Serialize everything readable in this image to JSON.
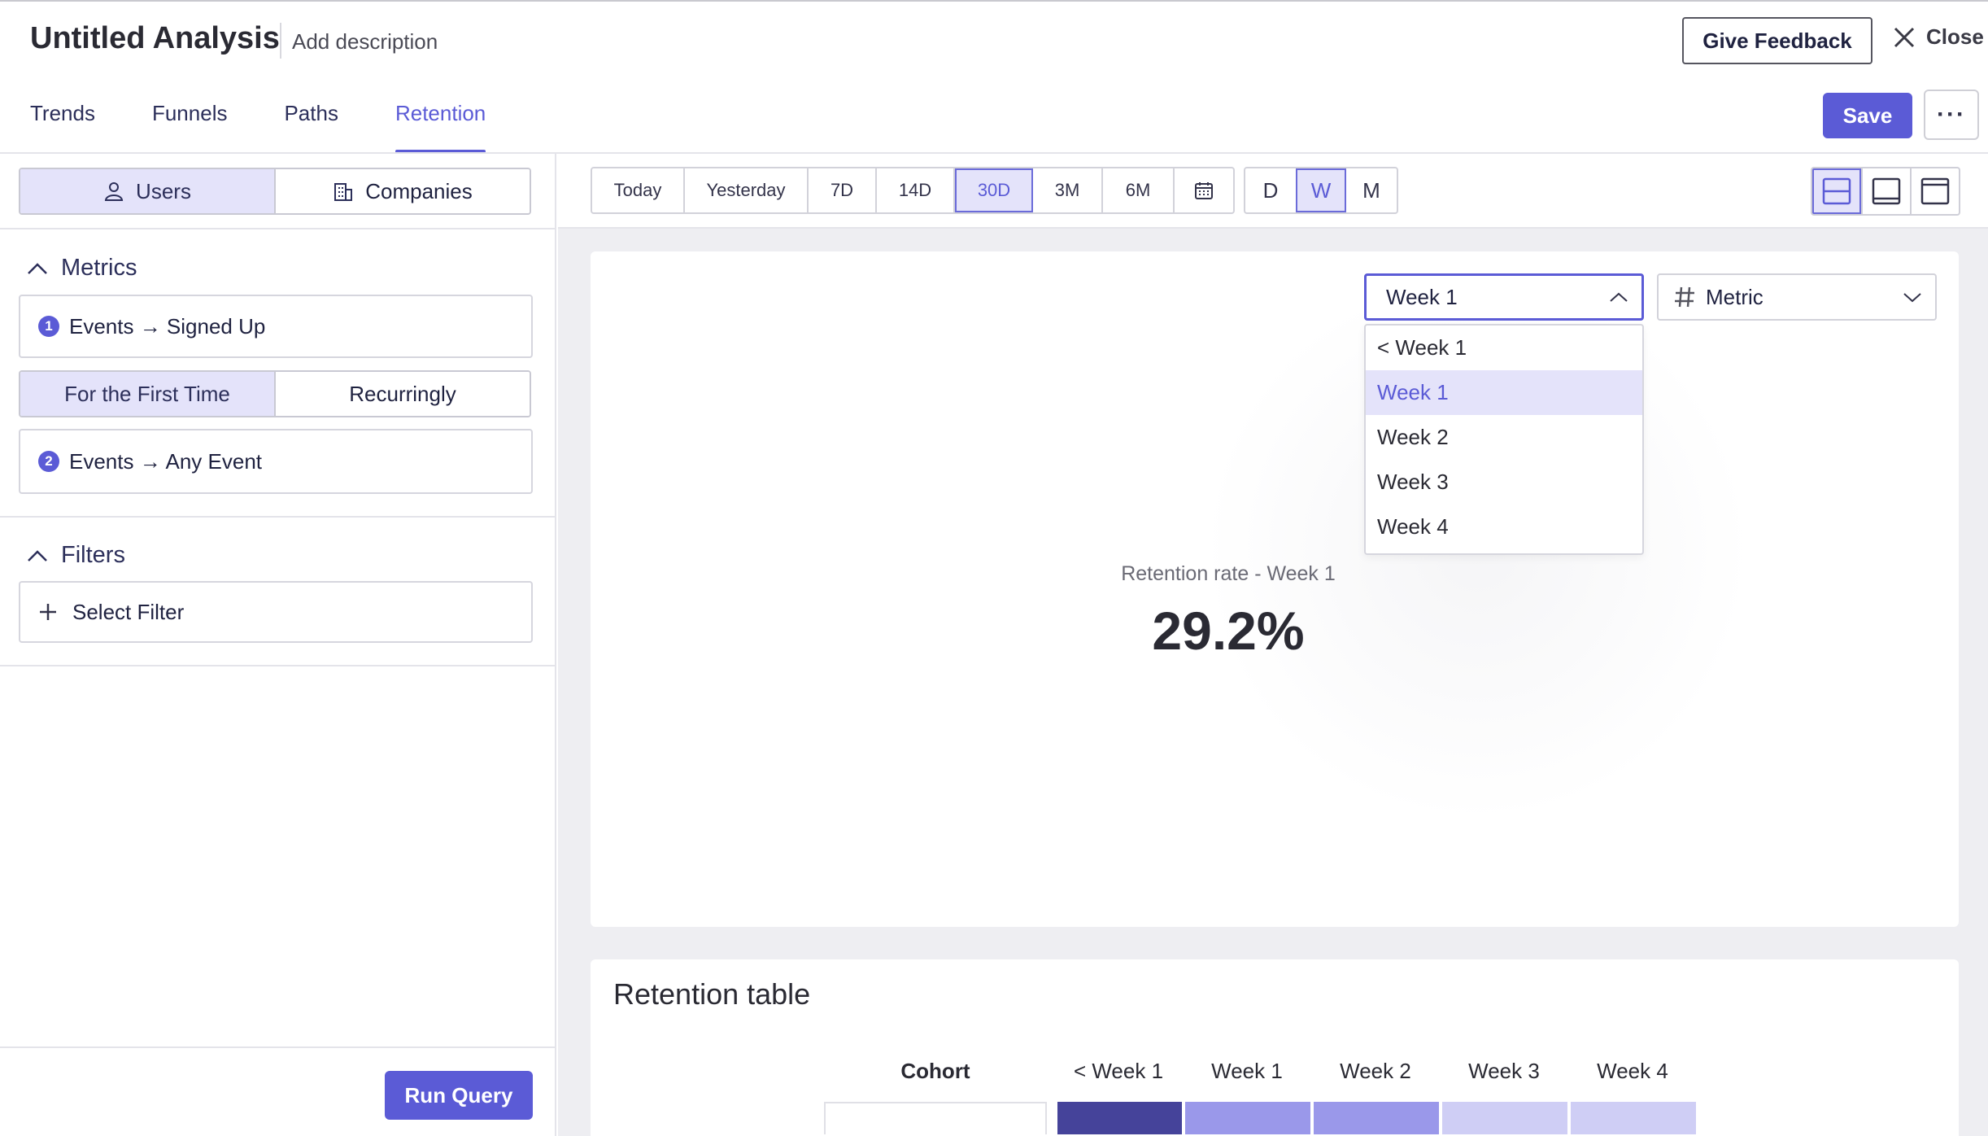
{
  "header": {
    "title": "Untitled Analysis",
    "description": "Add description",
    "feedback_label": "Give Feedback",
    "close_label": "Close",
    "save_label": "Save",
    "more_label": "···"
  },
  "tabs": [
    {
      "label": "Trends",
      "active": false
    },
    {
      "label": "Funnels",
      "active": false
    },
    {
      "label": "Paths",
      "active": false
    },
    {
      "label": "Retention",
      "active": true
    }
  ],
  "sidebar": {
    "entity_toggle": [
      {
        "label": "Users",
        "icon": "user-icon",
        "active": true
      },
      {
        "label": "Companies",
        "icon": "building-icon",
        "active": false
      }
    ],
    "metrics_heading": "Metrics",
    "metric1": {
      "number": "1",
      "label": "Events → Signed Up"
    },
    "frequency_toggle": [
      {
        "label": "For the First Time",
        "active": true
      },
      {
        "label": "Recurringly",
        "active": false
      }
    ],
    "metric2": {
      "number": "2",
      "label": "Events → Any Event"
    },
    "filters_heading": "Filters",
    "select_filter": "Select Filter",
    "run_query": "Run Query"
  },
  "toolbar": {
    "ranges": [
      "Today",
      "Yesterday",
      "7D",
      "14D",
      "30D",
      "3M",
      "6M"
    ],
    "active_range": "30D",
    "granularity": [
      "D",
      "W",
      "M"
    ],
    "active_granularity": "W",
    "layouts": [
      "layout-split-icon",
      "layout-bottom-icon",
      "layout-top-icon"
    ]
  },
  "chart_panel": {
    "week_select": "Week 1",
    "metric_select": "Metric",
    "dropdown_options": [
      "< Week 1",
      "Week 1",
      "Week 2",
      "Week 3",
      "Week 4"
    ],
    "dropdown_selected": "Week 1",
    "rate_label": "Retention rate - Week 1",
    "rate_value": "29.2%"
  },
  "retention_table": {
    "title": "Retention table",
    "columns": [
      "Cohort",
      "< Week 1",
      "Week 1",
      "Week 2",
      "Week 3",
      "Week 4"
    ],
    "heat_colors": [
      "#45439a",
      "#9a98ea",
      "#9a98ea",
      "#cfcef5",
      "#cfcef5"
    ]
  },
  "colors": {
    "accent": "#5b5bd6",
    "accent_light": "#e4e3fa"
  }
}
